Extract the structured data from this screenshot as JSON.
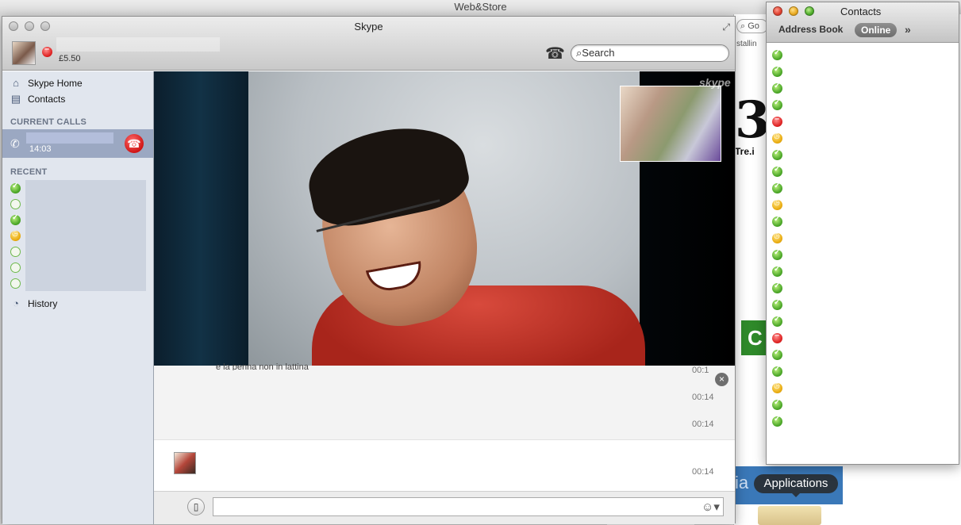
{
  "desktop": {
    "window_title": "Web&Store",
    "browser_search_partial": "Go",
    "browser_install_partial": "stallin",
    "tre_label": "Tre.i",
    "promo_letter": "C",
    "promo_partial": "ia",
    "dock_tooltip": "Applications"
  },
  "skype": {
    "title": "Skype",
    "credit": "£5.50",
    "search_placeholder": "Search",
    "nav": {
      "home": "Skype Home",
      "contacts": "Contacts",
      "history": "History"
    },
    "sections": {
      "current_calls": "CURRENT CALLS",
      "recent": "RECENT"
    },
    "current_call": {
      "duration": "14:03"
    },
    "recent_statuses": [
      "online",
      "offline",
      "online",
      "away",
      "offline",
      "offline",
      "offline"
    ],
    "watermark": "skype",
    "chat": {
      "partial_text": "e la penna non in lattina",
      "timestamps": [
        "00:1",
        "00:14",
        "00:14",
        "00:14"
      ]
    }
  },
  "contacts": {
    "title": "Contacts",
    "tabs": {
      "address_book": "Address Book",
      "online": "Online",
      "more": "»"
    },
    "statuses": [
      "online",
      "online",
      "online",
      "online",
      "busy",
      "away",
      "online",
      "online",
      "online",
      "away",
      "online",
      "away",
      "online",
      "online",
      "online",
      "online",
      "online",
      "busy",
      "online",
      "online",
      "away",
      "online",
      "online"
    ]
  },
  "colors": {
    "accent_call_row": "#9ba8c2",
    "sidebar_bg": "#e1e6ee",
    "hangup": "#d01515"
  }
}
